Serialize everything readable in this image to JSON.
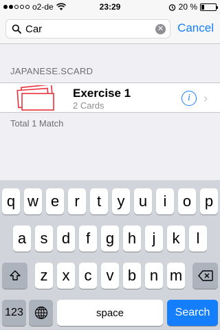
{
  "status_bar": {
    "carrier": "o2-de",
    "time": "23:29",
    "battery": "20 %",
    "battery_level": 0.2
  },
  "search": {
    "value": "Car",
    "cancel_label": "Cancel"
  },
  "results": {
    "section_title": "JAPANESE.SCARD",
    "items": [
      {
        "title": "Exercise 1",
        "subtitle": "2 Cards"
      }
    ],
    "footer": "Total 1 Match"
  },
  "keyboard": {
    "row1": [
      "q",
      "w",
      "e",
      "r",
      "t",
      "y",
      "u",
      "i",
      "o",
      "p"
    ],
    "row2": [
      "a",
      "s",
      "d",
      "f",
      "g",
      "h",
      "j",
      "k",
      "l"
    ],
    "row3": [
      "z",
      "x",
      "c",
      "v",
      "b",
      "n",
      "m"
    ],
    "numbers_label": "123",
    "space_label": "space",
    "search_label": "Search"
  },
  "colors": {
    "accent": "#157efb",
    "card_red": "#e8303a"
  }
}
